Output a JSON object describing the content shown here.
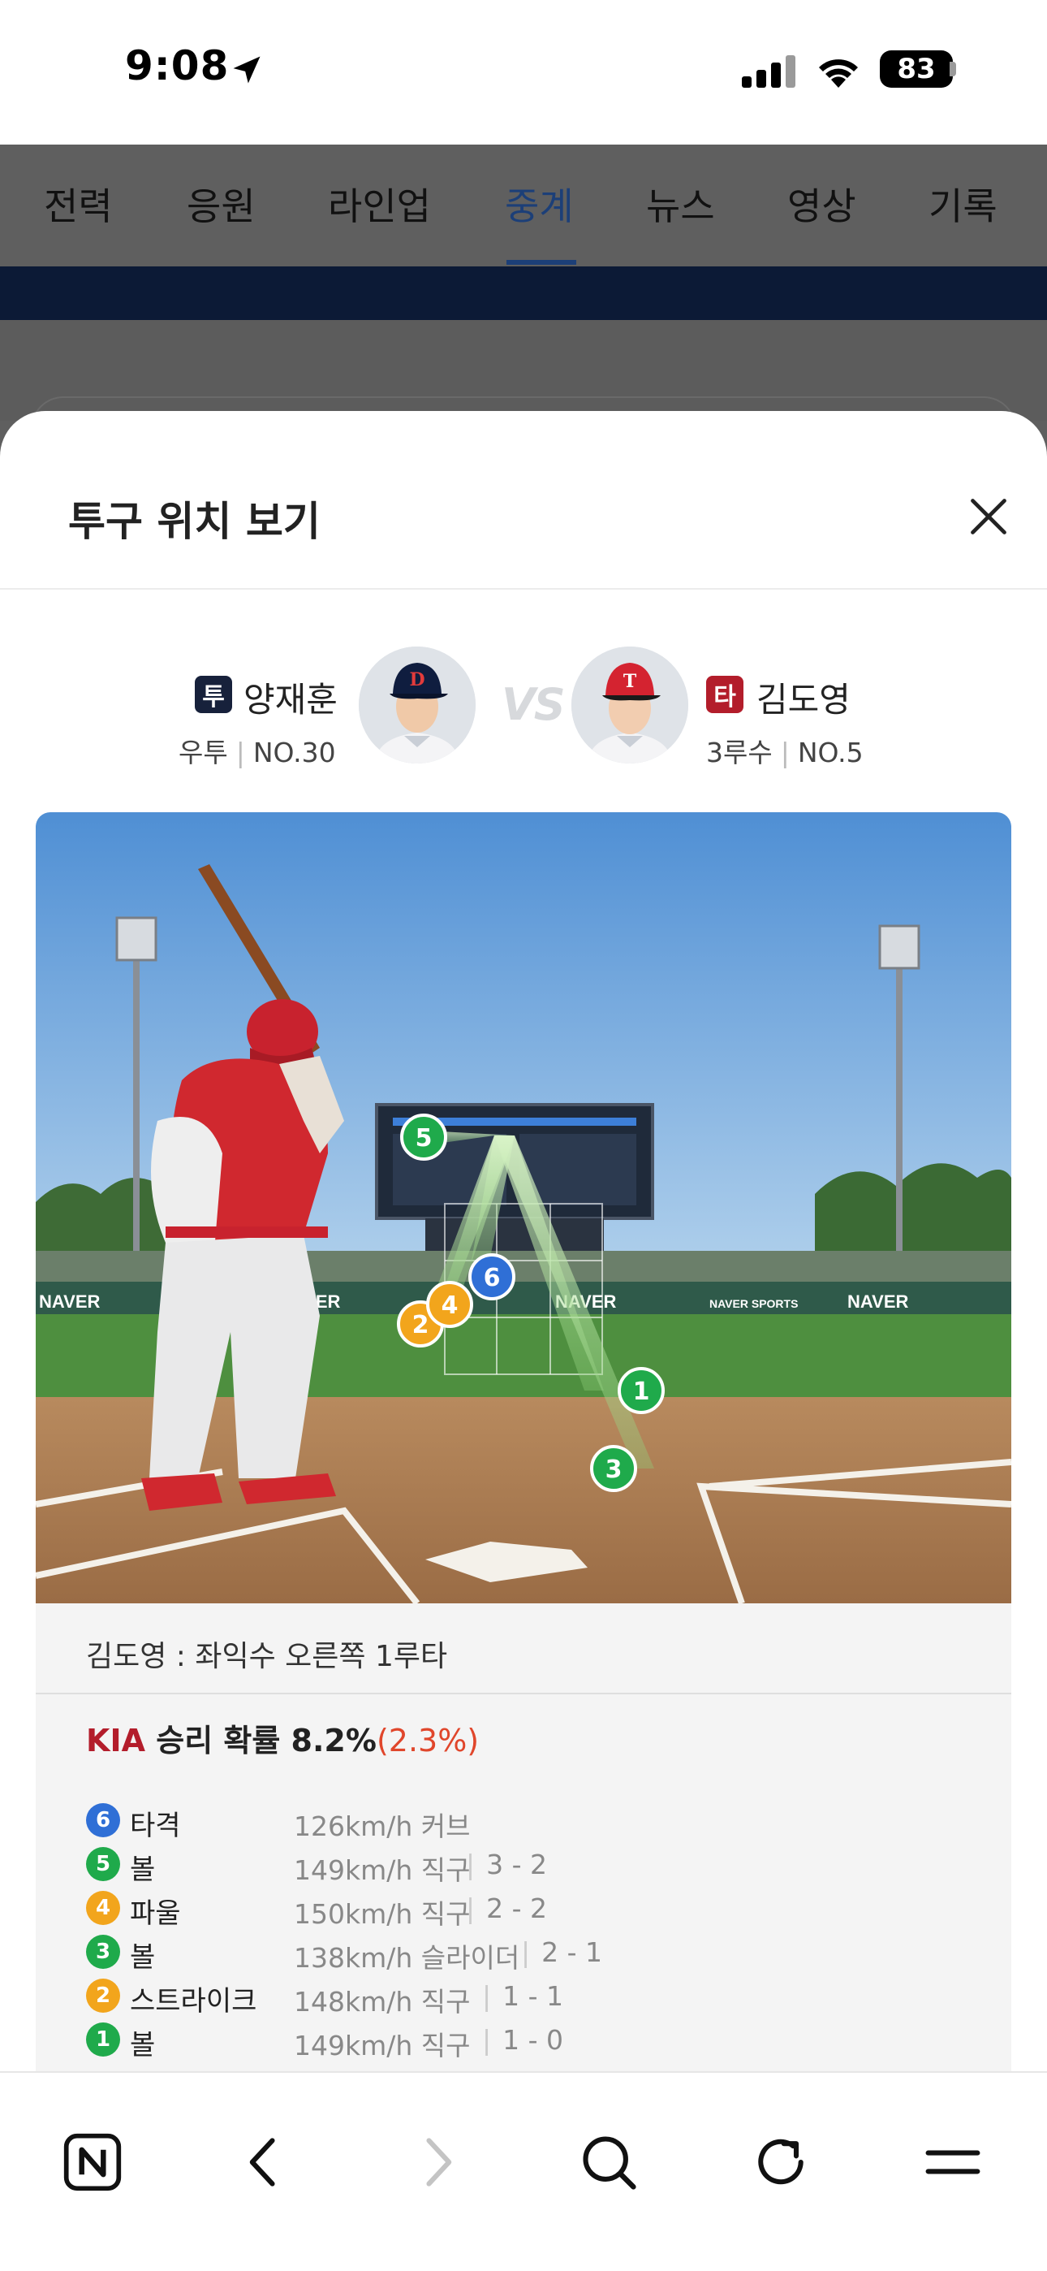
{
  "status": {
    "time": "9:08",
    "battery": "83"
  },
  "nav_tabs": [
    "전력",
    "응원",
    "라인업",
    "중계",
    "뉴스",
    "영상",
    "기록"
  ],
  "active_tab": "중계",
  "sheet": {
    "title": "투구 위치 보기"
  },
  "matchup": {
    "pitcher": {
      "badge": "투",
      "name": "양재훈",
      "hand": "우투",
      "number": "NO.30"
    },
    "vs": "VS",
    "batter": {
      "badge": "타",
      "name": "김도영",
      "position": "3루수",
      "number": "NO.5"
    }
  },
  "field_ads": [
    "NAVER",
    "NAVER",
    "NAVER",
    "NAVER",
    "NAVER SPORTS",
    "NAVER"
  ],
  "pitch_markers": [
    "1",
    "2",
    "3",
    "4",
    "5",
    "6"
  ],
  "result": "김도영 : 좌익수 오른쪽 1루타",
  "win_probability": {
    "team": "KIA",
    "label": "승리 확률",
    "value": "8.2%",
    "delta": "(2.3%)"
  },
  "pitches": [
    {
      "num": "6",
      "result": "타격",
      "speed": "126km/h 커브",
      "count": ""
    },
    {
      "num": "5",
      "result": "볼",
      "speed": "149km/h 직구",
      "count": "3 - 2"
    },
    {
      "num": "4",
      "result": "파울",
      "speed": "150km/h 직구",
      "count": "2 - 2"
    },
    {
      "num": "3",
      "result": "볼",
      "speed": "138km/h 슬라이더",
      "count": "2 - 1"
    },
    {
      "num": "2",
      "result": "스트라이크",
      "speed": "148km/h 직구",
      "count": "1 - 1"
    },
    {
      "num": "1",
      "result": "볼",
      "speed": "149km/h 직구",
      "count": "1 - 0"
    }
  ],
  "colors": {
    "ball": "#1faa4b",
    "strike": "#f2a51c",
    "hit": "#2f6fd6",
    "pitcher_badge": "#17213b",
    "batter_badge": "#b31d2b",
    "accent_tab": "#1c3f78"
  }
}
